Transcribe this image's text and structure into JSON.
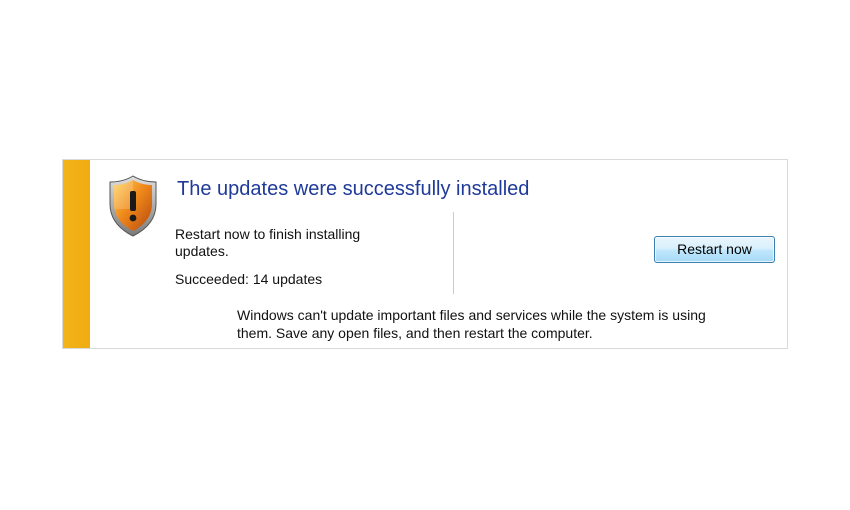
{
  "notification": {
    "title": "The updates were successfully installed",
    "description": "Restart now to finish installing updates.",
    "status": "Succeeded: 14 updates",
    "note": "Windows can't update important files and services while the system is using them. Save any open files, and then restart the computer.",
    "restart_button_label": "Restart now",
    "icon": "shield-warning-icon",
    "colors": {
      "accent_bar": "#f0ac12",
      "title": "#1f3a99",
      "shield_orange": "#e8731a"
    }
  }
}
